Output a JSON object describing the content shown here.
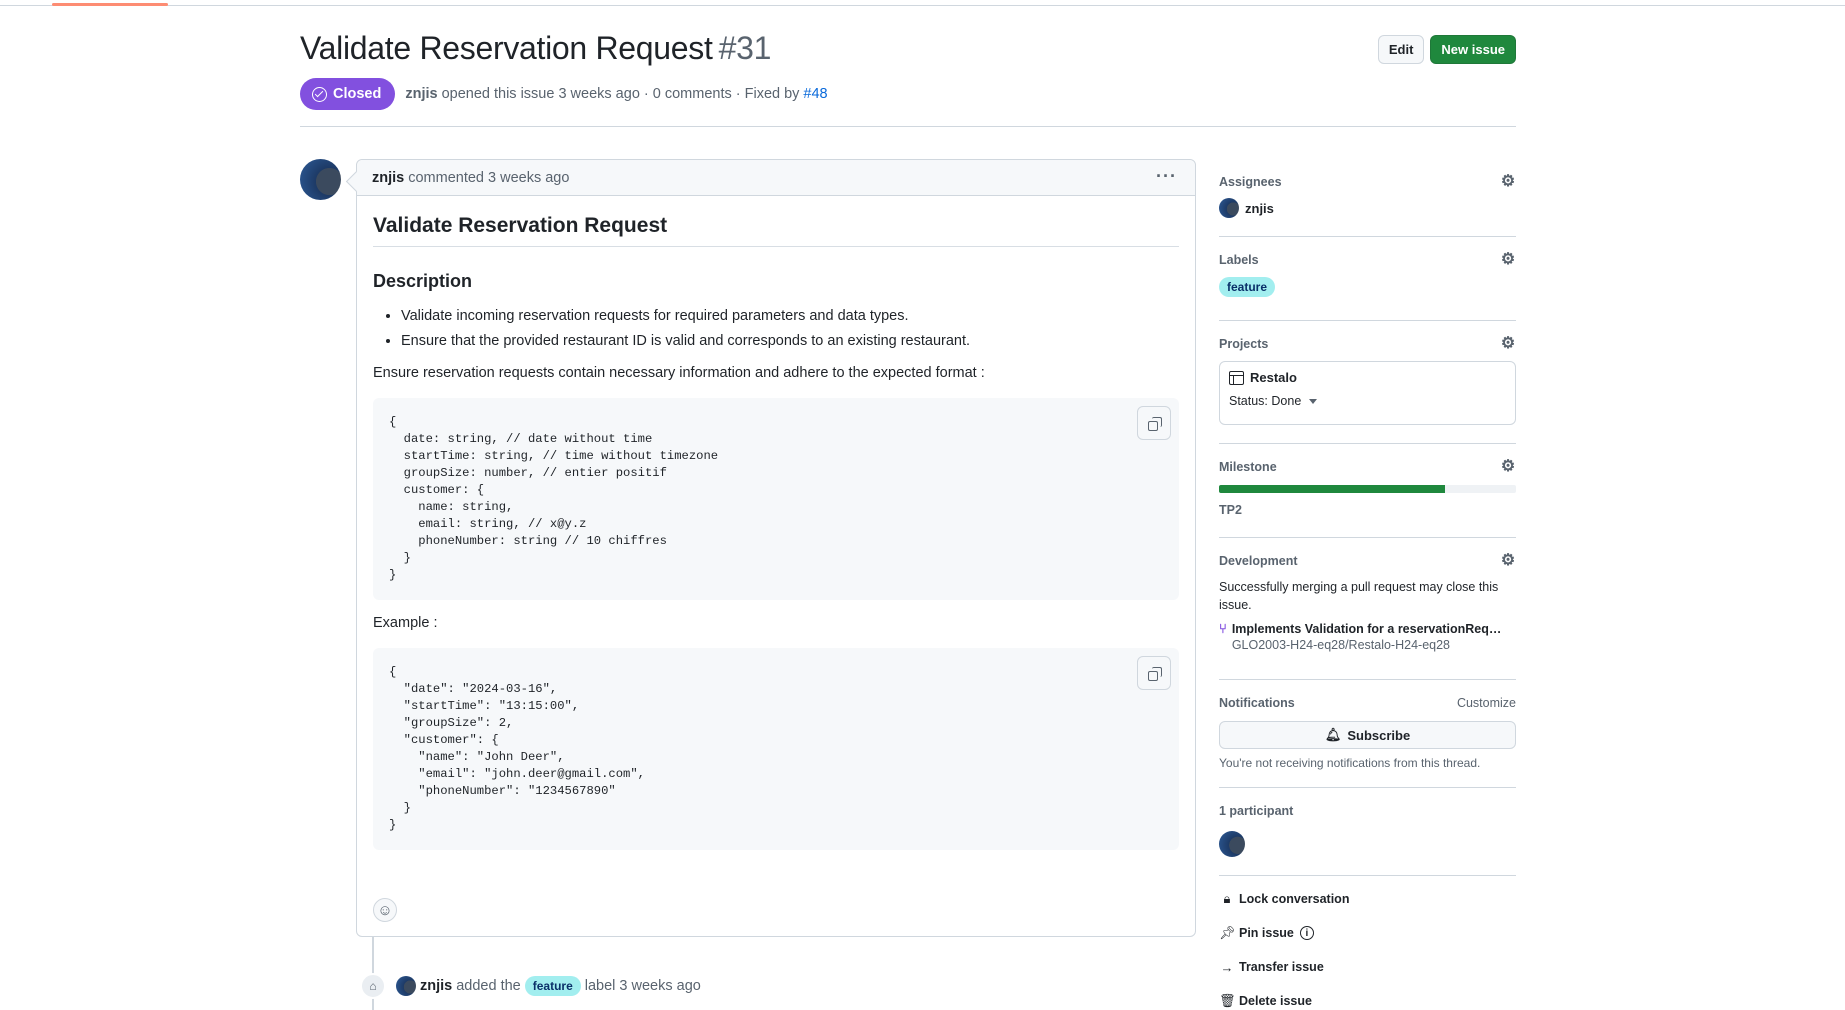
{
  "issue": {
    "title": "Validate Reservation Request",
    "number": "#31",
    "state": "Closed",
    "author": "znjis",
    "opened_text": "opened this issue 3 weeks ago · 0 comments · Fixed by",
    "fixed_by": "#48"
  },
  "actions": {
    "edit": "Edit",
    "new_issue": "New issue"
  },
  "comment": {
    "author": "znjis",
    "time": "commented 3 weeks ago",
    "more": "···",
    "heading": "Validate Reservation Request",
    "subheading": "Description",
    "bullets": [
      "Validate incoming reservation requests for required parameters and data types.",
      "Ensure that the provided restaurant ID is valid and corresponds to an existing restaurant."
    ],
    "intro": "Ensure reservation requests contain necessary information and adhere to the expected format :",
    "code_schema": "{\n  date: string, // date without time\n  startTime: string, // time without timezone\n  groupSize: number, // entier positif\n  customer: {\n    name: string,\n    email: string, // x@y.z\n    phoneNumber: string // 10 chiffres\n  }\n}",
    "example_label": "Example :",
    "code_example": "{\n  \"date\": \"2024-03-16\",\n  \"startTime\": \"13:15:00\",\n  \"groupSize\": 2,\n  \"customer\": {\n    \"name\": \"John Deer\",\n    \"email\": \"john.deer@gmail.com\",\n    \"phoneNumber\": \"1234567890\"\n  }\n}"
  },
  "event": {
    "author": "znjis",
    "text_before": "added the",
    "label": "feature",
    "text_after": "label 3 weeks ago"
  },
  "sidebar": {
    "assignees": {
      "title": "Assignees",
      "name": "znjis"
    },
    "labels": {
      "title": "Labels",
      "label": "feature"
    },
    "projects": {
      "title": "Projects",
      "name": "Restalo",
      "status": "Status: Done"
    },
    "milestone": {
      "title": "Milestone",
      "name": "TP2",
      "progress": 0.76
    },
    "development": {
      "title": "Development",
      "text": "Successfully merging a pull request may close this issue.",
      "pr_title": "Implements Validation for a reservationRequest",
      "pr_repo": "GLO2003-H24-eq28/Restalo-H24-eq28"
    },
    "notifications": {
      "title": "Notifications",
      "customize": "Customize",
      "subscribe": "Subscribe",
      "text": "You're not receiving notifications from this thread."
    },
    "participants": {
      "title": "1 participant"
    },
    "actions": {
      "lock": "Lock conversation",
      "pin": "Pin issue",
      "transfer": "Transfer issue",
      "delete": "Delete issue"
    }
  },
  "colors": {
    "closed_badge": "#8250df",
    "primary_button": "#1f883d",
    "label_feature": "#a2eeef",
    "link": "#0969da"
  },
  "icons": [
    "check-circle-icon",
    "kebab-horizontal-icon",
    "copy-icon",
    "smiley-icon",
    "tag-icon",
    "gear-icon",
    "table-icon",
    "triangle-down-icon",
    "git-pull-request-icon",
    "bell-icon",
    "lock-icon",
    "pin-icon",
    "info-icon",
    "arrow-right-icon",
    "trash-icon"
  ]
}
